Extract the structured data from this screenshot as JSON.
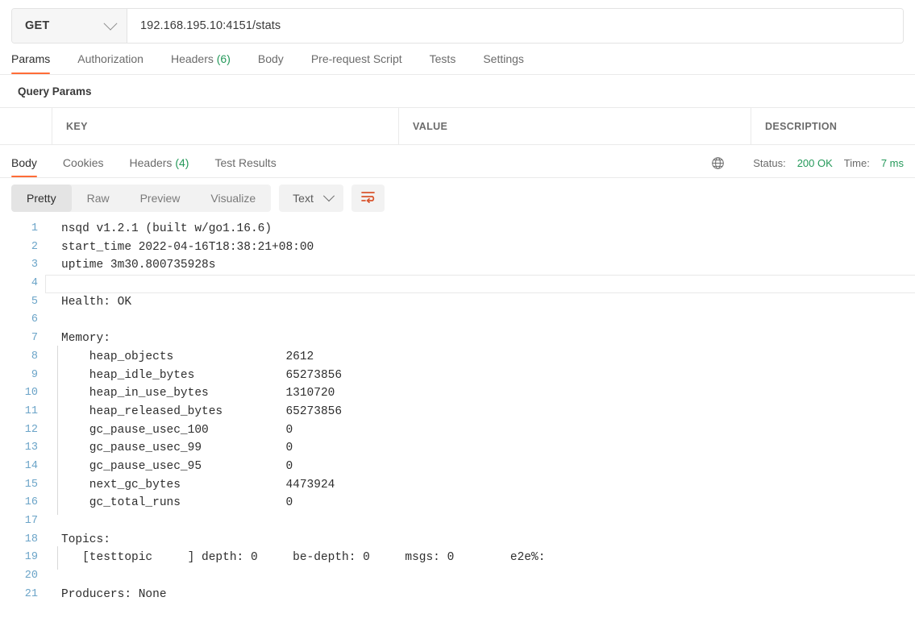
{
  "request": {
    "method": "GET",
    "url": "192.168.195.10:4151/stats",
    "tabs": [
      {
        "label": "Params",
        "active": true
      },
      {
        "label": "Authorization",
        "active": false
      },
      {
        "label": "Headers",
        "count": "(6)",
        "active": false
      },
      {
        "label": "Body",
        "active": false
      },
      {
        "label": "Pre-request Script",
        "active": false
      },
      {
        "label": "Tests",
        "active": false
      },
      {
        "label": "Settings",
        "active": false
      }
    ]
  },
  "query_params": {
    "title": "Query Params",
    "columns": [
      "KEY",
      "VALUE",
      "DESCRIPTION"
    ],
    "rows": []
  },
  "response": {
    "tabs": [
      {
        "label": "Body",
        "active": true
      },
      {
        "label": "Cookies",
        "active": false
      },
      {
        "label": "Headers",
        "count": "(4)",
        "active": false
      },
      {
        "label": "Test Results",
        "active": false
      }
    ],
    "meta": {
      "globe_icon": "globe-icon",
      "status_label": "Status:",
      "status_value": "200 OK",
      "time_label": "Time:",
      "time_value": "7 ms"
    },
    "format_tabs": [
      {
        "label": "Pretty",
        "active": true
      },
      {
        "label": "Raw",
        "active": false
      },
      {
        "label": "Preview",
        "active": false
      },
      {
        "label": "Visualize",
        "active": false
      }
    ],
    "language_dropdown": "Text",
    "wrap_button_icon": "wrap-text-icon",
    "body_lines": [
      {
        "n": "1",
        "text": "nsqd v1.2.1 (built w/go1.16.6)",
        "indent": false,
        "cursor": false
      },
      {
        "n": "2",
        "text": "start_time 2022-04-16T18:38:21+08:00",
        "indent": false,
        "cursor": false
      },
      {
        "n": "3",
        "text": "uptime 3m30.800735928s",
        "indent": false,
        "cursor": false
      },
      {
        "n": "4",
        "text": "",
        "indent": false,
        "cursor": true
      },
      {
        "n": "5",
        "text": "Health: OK",
        "indent": false,
        "cursor": false
      },
      {
        "n": "6",
        "text": "",
        "indent": false,
        "cursor": false
      },
      {
        "n": "7",
        "text": "Memory:",
        "indent": false,
        "cursor": false
      },
      {
        "n": "8",
        "text": "    heap_objects                2612",
        "indent": true,
        "cursor": false
      },
      {
        "n": "9",
        "text": "    heap_idle_bytes             65273856",
        "indent": true,
        "cursor": false
      },
      {
        "n": "10",
        "text": "    heap_in_use_bytes           1310720",
        "indent": true,
        "cursor": false
      },
      {
        "n": "11",
        "text": "    heap_released_bytes         65273856",
        "indent": true,
        "cursor": false
      },
      {
        "n": "12",
        "text": "    gc_pause_usec_100           0",
        "indent": true,
        "cursor": false
      },
      {
        "n": "13",
        "text": "    gc_pause_usec_99            0",
        "indent": true,
        "cursor": false
      },
      {
        "n": "14",
        "text": "    gc_pause_usec_95            0",
        "indent": true,
        "cursor": false
      },
      {
        "n": "15",
        "text": "    next_gc_bytes               4473924",
        "indent": true,
        "cursor": false
      },
      {
        "n": "16",
        "text": "    gc_total_runs               0",
        "indent": true,
        "cursor": false
      },
      {
        "n": "17",
        "text": "",
        "indent": false,
        "cursor": false
      },
      {
        "n": "18",
        "text": "Topics:",
        "indent": false,
        "cursor": false
      },
      {
        "n": "19",
        "text": "   [testtopic     ] depth: 0     be-depth: 0     msgs: 0        e2e%:",
        "indent": true,
        "cursor": false
      },
      {
        "n": "20",
        "text": "",
        "indent": false,
        "cursor": false
      },
      {
        "n": "21",
        "text": "Producers: None",
        "indent": false,
        "cursor": false
      }
    ]
  },
  "colors": {
    "accent": "#ff6c37",
    "success": "#25995a",
    "line_number": "#6ba4c8",
    "text": "#2e2e2e"
  }
}
